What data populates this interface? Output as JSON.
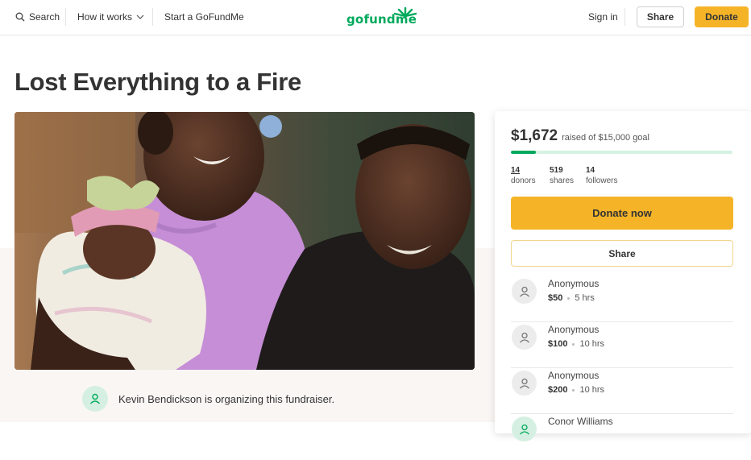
{
  "header": {
    "search_label": "Search",
    "how_it_works_label": "How it works",
    "start_label": "Start a GoFundMe",
    "logo_text": "gofundme",
    "sign_in_label": "Sign in",
    "share_label": "Share",
    "donate_label": "Donate"
  },
  "campaign": {
    "title": "Lost Everything to a Fire",
    "organizer_text": "Kevin Bendickson is organizing this fundraiser."
  },
  "card": {
    "raised_amount": "$1,672",
    "goal_text": "raised of $15,000 goal",
    "progress_fraction": 0.111,
    "stats": [
      {
        "value": "14",
        "label": "donors"
      },
      {
        "value": "519",
        "label": "shares"
      },
      {
        "value": "14",
        "label": "followers"
      }
    ],
    "donate_now_label": "Donate now",
    "share_label": "Share",
    "donations": [
      {
        "name": "Anonymous",
        "amount": "$50",
        "time": "5 hrs"
      },
      {
        "name": "Anonymous",
        "amount": "$100",
        "time": "10 hrs"
      },
      {
        "name": "Anonymous",
        "amount": "$200",
        "time": "10 hrs"
      },
      {
        "name": "Conor Williams",
        "amount": "",
        "time": ""
      }
    ]
  },
  "colors": {
    "brand_green": "#02a95c",
    "donate_yellow": "#f5b428"
  }
}
